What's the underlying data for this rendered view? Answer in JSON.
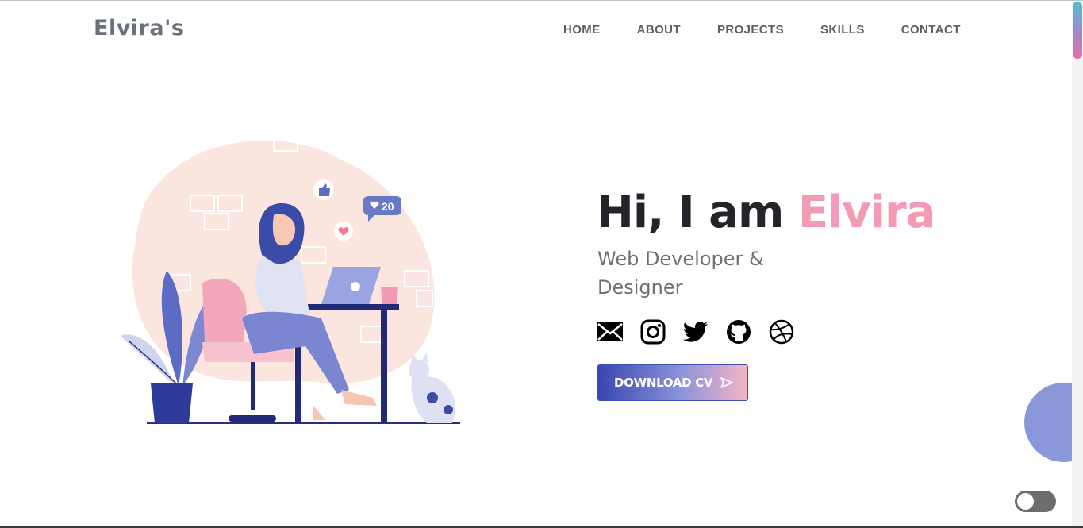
{
  "header": {
    "logo": "Elvira's",
    "nav": [
      "HOME",
      "ABOUT",
      "PROJECTS",
      "SKILLS",
      "CONTACT"
    ]
  },
  "hero": {
    "greeting_prefix": "Hi, I am ",
    "name": "Elvira",
    "role": "Web Developer & Designer",
    "download_label": "DOWNLOAD CV",
    "illustration": {
      "notification_count": "20"
    }
  },
  "socials": [
    "mail-icon",
    "instagram-icon",
    "twitter-icon",
    "github-icon",
    "dribbble-icon"
  ],
  "colors": {
    "accent_pink": "#f39bb4",
    "accent_blue": "#3a46b0",
    "circle": "#8a97d8",
    "text_dark": "#232429"
  }
}
